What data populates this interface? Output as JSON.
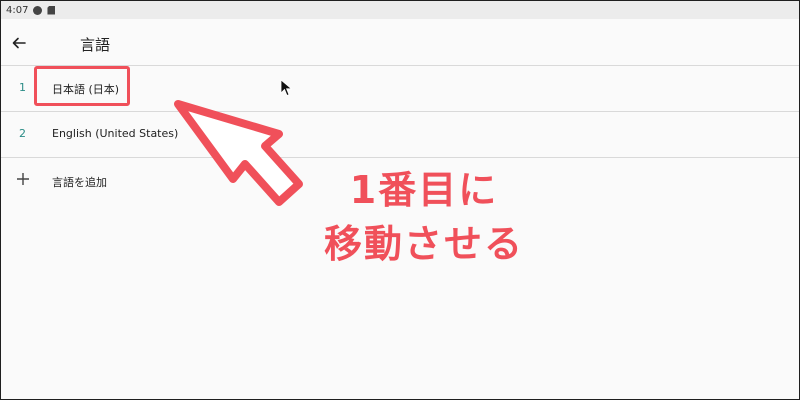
{
  "statusbar": {
    "time": "4:07"
  },
  "appbar": {
    "title": "言語"
  },
  "languages": [
    {
      "number": "1",
      "label": "日本語 (日本)"
    },
    {
      "number": "2",
      "label": "English (United States)"
    }
  ],
  "add_language": {
    "label": "言語を追加"
  },
  "annotation": {
    "line1": "1番目に",
    "line2": "移動させる"
  },
  "colors": {
    "accent_number": "#2a8c86",
    "annotation": "#f0505a"
  }
}
